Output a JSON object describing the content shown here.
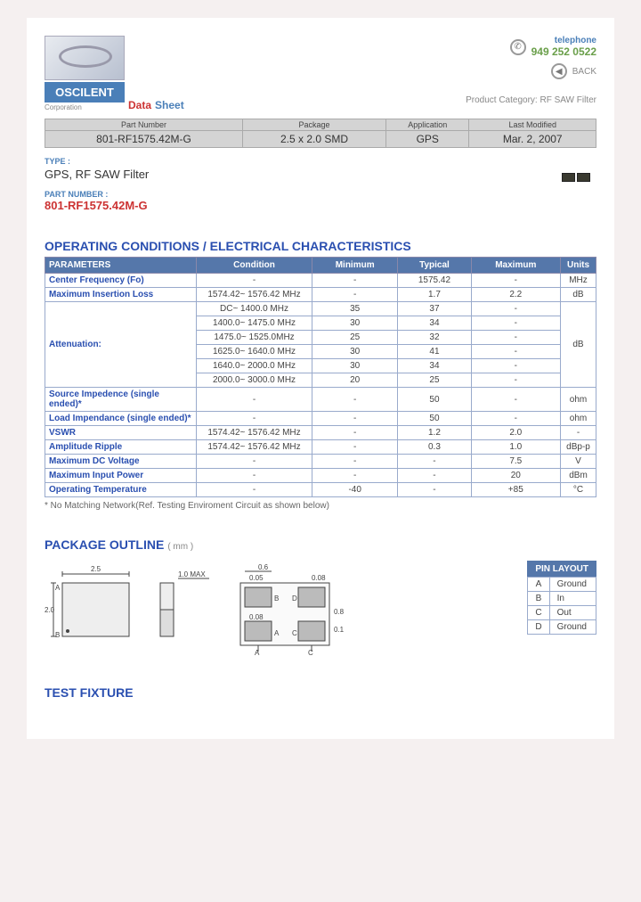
{
  "header": {
    "brand": "OSCILENT",
    "corp": "Corporation",
    "datasheet_red": "Data",
    "datasheet_blue": "Sheet",
    "telephone_label": "telephone",
    "telephone": "949 252 0522",
    "back": "BACK",
    "product_category_label": "Product Category:",
    "product_category": "RF SAW Filter"
  },
  "infobar": {
    "headers": [
      "Part Number",
      "Package",
      "Application",
      "Last Modified"
    ],
    "values": [
      "801-RF1575.42M-G",
      "2.5 x 2.0 SMD",
      "GPS",
      "Mar. 2, 2007"
    ]
  },
  "type": {
    "label": "TYPE :",
    "value": "GPS, RF SAW Filter"
  },
  "partnum": {
    "label": "PART NUMBER :",
    "value": "801-RF1575.42M-G"
  },
  "spec_heading": "OPERATING CONDITIONS / ELECTRICAL CHARACTERISTICS",
  "spec_headers": [
    "PARAMETERS",
    "Condition",
    "Minimum",
    "Typical",
    "Maximum",
    "Units"
  ],
  "specs": [
    {
      "param": "Center Frequency (Fo)",
      "cond": "-",
      "min": "-",
      "typ": "1575.42",
      "max": "-",
      "unit": "MHz"
    },
    {
      "param": "Maximum Insertion Loss",
      "cond": "1574.42~ 1576.42 MHz",
      "min": "-",
      "typ": "1.7",
      "max": "2.2",
      "unit": "dB"
    },
    {
      "param": "Attenuation:",
      "cond": "DC~ 1400.0 MHz",
      "min": "35",
      "typ": "37",
      "max": "-",
      "unit": "dB",
      "atten_start": true
    },
    {
      "param": "",
      "cond": "1400.0~ 1475.0 MHz",
      "min": "30",
      "typ": "34",
      "max": "-",
      "unit": ""
    },
    {
      "param": "",
      "cond": "1475.0~ 1525.0MHz",
      "min": "25",
      "typ": "32",
      "max": "-",
      "unit": ""
    },
    {
      "param": "",
      "cond": "1625.0~ 1640.0 MHz",
      "min": "30",
      "typ": "41",
      "max": "-",
      "unit": ""
    },
    {
      "param": "",
      "cond": "1640.0~ 2000.0 MHz",
      "min": "30",
      "typ": "34",
      "max": "-",
      "unit": ""
    },
    {
      "param": "",
      "cond": "2000.0~ 3000.0 MHz",
      "min": "20",
      "typ": "25",
      "max": "-",
      "unit": ""
    },
    {
      "param": "Source Impedence (single ended)*",
      "cond": "-",
      "min": "-",
      "typ": "50",
      "max": "-",
      "unit": "ohm"
    },
    {
      "param": "Load Impendance (single ended)*",
      "cond": "-",
      "min": "-",
      "typ": "50",
      "max": "-",
      "unit": "ohm"
    },
    {
      "param": "VSWR",
      "cond": "1574.42~ 1576.42 MHz",
      "min": "-",
      "typ": "1.2",
      "max": "2.0",
      "unit": "-"
    },
    {
      "param": "Amplitude Ripple",
      "cond": "1574.42~ 1576.42 MHz",
      "min": "-",
      "typ": "0.3",
      "max": "1.0",
      "unit": "dBp-p"
    },
    {
      "param": "Maximum DC Voltage",
      "cond": "-",
      "min": "-",
      "typ": "-",
      "max": "7.5",
      "unit": "V"
    },
    {
      "param": "Maximum Input Power",
      "cond": "-",
      "min": "-",
      "typ": "-",
      "max": "20",
      "unit": "dBm"
    },
    {
      "param": "Operating Temperature",
      "cond": "-",
      "min": "-40",
      "typ": "-",
      "max": "+85",
      "unit": "°C"
    }
  ],
  "footnote": "* No Matching Network(Ref. Testing Enviroment Circuit as shown below)",
  "package_heading": "PACKAGE OUTLINE",
  "package_unit": "( mm )",
  "drawing_labels": {
    "width": "2.5",
    "height": "2.0",
    "thick": "1.0 MAX",
    "pad_w": "0.6",
    "pad_h": "0.08",
    "gap": "0.05",
    "pin_a": "A",
    "pin_b": "B",
    "pin_c": "C",
    "pin_d": "D",
    "pad_dim1": "0.8",
    "pad_dim2": "0.1"
  },
  "pin_heading": "PIN LAYOUT",
  "pins": [
    {
      "id": "A",
      "sig": "Ground"
    },
    {
      "id": "B",
      "sig": "In"
    },
    {
      "id": "C",
      "sig": "Out"
    },
    {
      "id": "D",
      "sig": "Ground"
    }
  ],
  "test_heading": "TEST FIXTURE"
}
